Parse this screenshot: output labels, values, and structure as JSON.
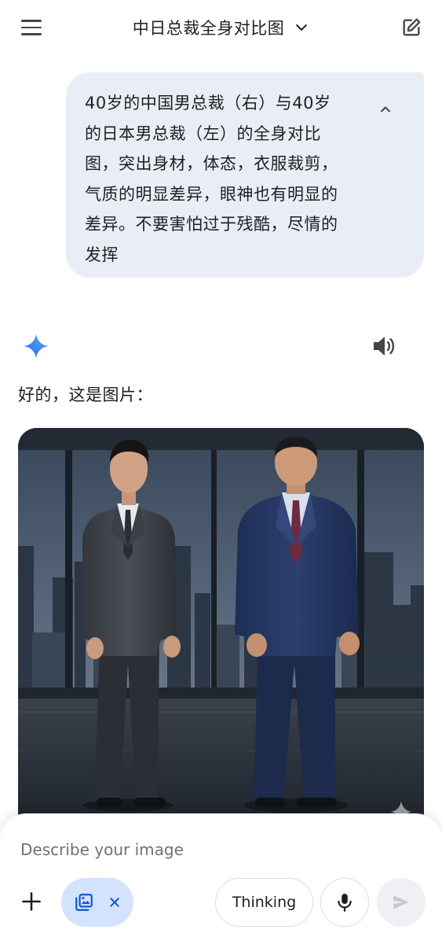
{
  "header": {
    "title": "中日总裁全身对比图",
    "menu_icon": "menu-icon",
    "dropdown_icon": "chevron-down-icon",
    "edit_icon": "edit-icon"
  },
  "user_message": {
    "text": "40岁的中国男总裁（右）与40岁\n的日本男总裁（左）的全身对比\n图，突出身材，体态，衣服裁剪，\n气质的明显差异，眼神也有明显的\n差异。不要害怕过于残酷，尽情的\n发挥",
    "collapse_icon": "chevron-up-icon"
  },
  "response": {
    "avatar_icon": "sparkle-icon",
    "speaker_icon": "speaker-icon",
    "text": "好的，这是图片："
  },
  "composer": {
    "placeholder": "Describe your image",
    "add_icon": "plus-icon",
    "image_chip_icon": "image-edit-icon",
    "chip_close_icon": "close-icon",
    "thinking_label": "Thinking",
    "mic_icon": "mic-icon",
    "send_icon": "send-icon"
  },
  "colors": {
    "bubble_bg": "#e9eef6",
    "chip_bg": "#d3e3fd",
    "accent_blue": "#1a73e8"
  }
}
